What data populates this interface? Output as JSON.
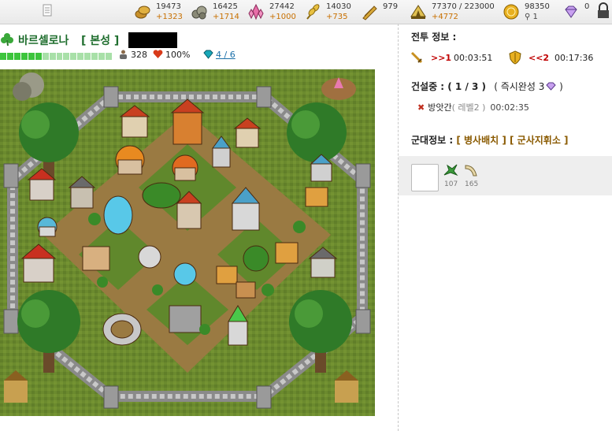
{
  "resources": [
    {
      "name": "food",
      "icon": "coins-icon",
      "amount": "19473",
      "income": "+1323"
    },
    {
      "name": "stone",
      "icon": "stone-icon",
      "amount": "16425",
      "income": "+1714"
    },
    {
      "name": "crystal",
      "icon": "crystal-icon",
      "amount": "27442",
      "income": "+1000"
    },
    {
      "name": "wheat",
      "icon": "wheat-icon",
      "amount": "14030",
      "income": "+735"
    },
    {
      "name": "grain",
      "icon": "grain-sack-icon",
      "amount": "979",
      "income": ""
    },
    {
      "name": "population",
      "icon": "tent-icon",
      "amount": "77370 / 223000",
      "income": "+4772"
    },
    {
      "name": "gold",
      "icon": "gold-coin-icon",
      "amount": "98350",
      "sub": "1"
    },
    {
      "name": "gem",
      "icon": "diamond-icon",
      "amount": "0",
      "income": ""
    }
  ],
  "city": {
    "name": "바르셀로나",
    "tag": "[ 본성 ]",
    "hp_filled": 6,
    "hp_total": 16,
    "population": "328",
    "loyalty": "100%",
    "slots": "4 / 6"
  },
  "battle": {
    "title": "전투 정보 :",
    "attack_label": ">>1",
    "attack_time": "00:03:51",
    "defense_label": "<<2",
    "defense_time": "00:17:36"
  },
  "construction": {
    "title": "건설중 : ( 1 / 3 )",
    "instant_label": "( 즉시완성 3",
    "instant_close": " )",
    "item_name": "방앗간",
    "item_level": "( 레벨2 )",
    "item_time": "00:02:35"
  },
  "army": {
    "title": "군대정보 :",
    "link1": "[ 병사배치 ]",
    "link2": "[ 군사지휘소 ]",
    "units": [
      {
        "icon": "dragon-unit-icon",
        "count": "107"
      },
      {
        "icon": "horn-unit-icon",
        "count": "165"
      }
    ]
  },
  "colors": {
    "city_green": "#1f6e2e",
    "income_orange": "#c87000",
    "attack_red": "#c00000",
    "link_blue": "#1a6ea8"
  }
}
